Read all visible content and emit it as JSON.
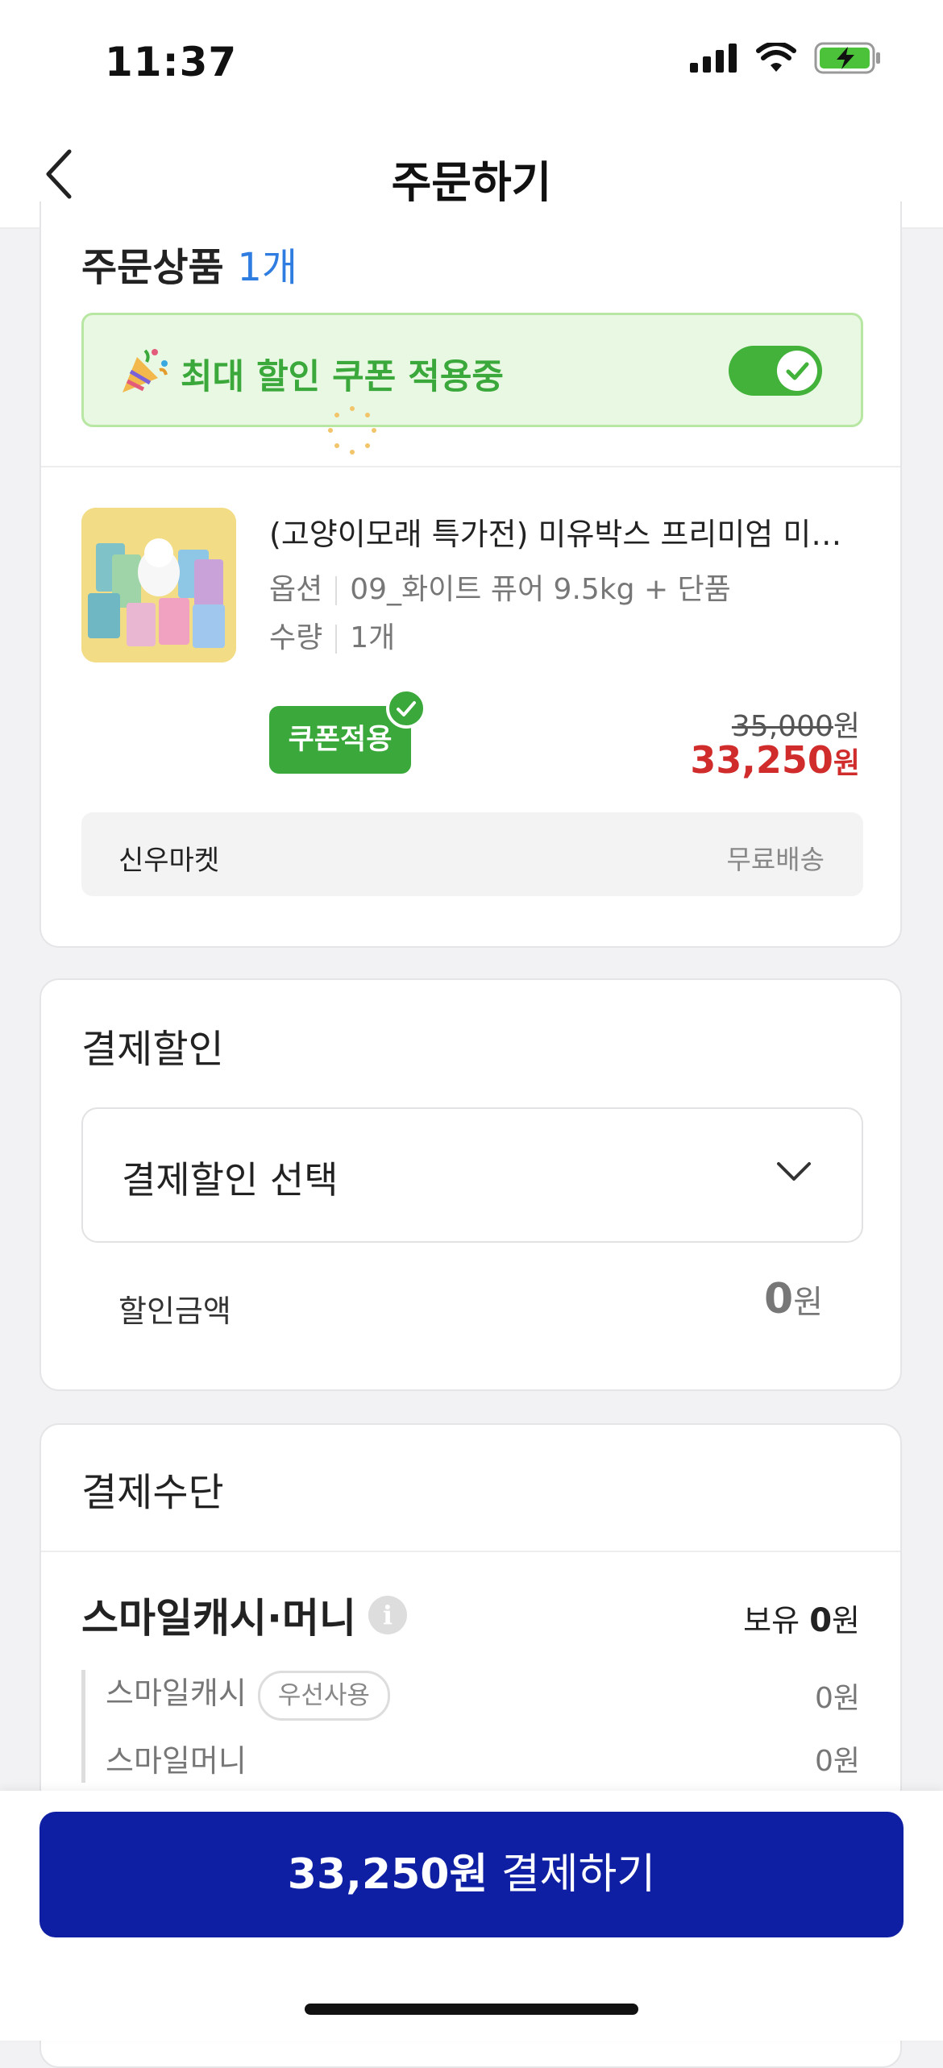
{
  "status_bar": {
    "time": "11:37"
  },
  "header": {
    "title": "주문하기"
  },
  "order_section": {
    "title": "주문상품",
    "count": "1개",
    "coupon_banner": {
      "text": "최대 할인 쿠폰 적용중",
      "toggle_on": true
    },
    "product": {
      "name": "(고양이모래 특가전) 미유박스 프리미엄 미…",
      "option_label": "옵션",
      "option_value": "09_화이트 퓨어 9.5kg + 단품",
      "qty_label": "수량",
      "qty_value": "1개",
      "coupon_badge": "쿠폰적용",
      "original_price": "35,000",
      "original_price_unit": "원",
      "sale_price": "33,250",
      "sale_price_unit": "원"
    },
    "seller": {
      "name": "신우마켓",
      "shipping": "무료배송"
    }
  },
  "payment_discount": {
    "title": "결제할인",
    "select_placeholder": "결제할인 선택",
    "amount_label": "할인금액",
    "amount_value": "0",
    "amount_unit": "원"
  },
  "payment_method": {
    "title": "결제수단",
    "smile": {
      "label": "스마일캐시·머니",
      "holding_label": "보유",
      "holding_value": "0",
      "holding_unit": "원",
      "cash_label": "스마일캐시",
      "cash_pill": "우선사용",
      "cash_value": "0원",
      "money_label": "스마일머니",
      "money_value": "0원"
    }
  },
  "pay_button": {
    "amount": "33,250원",
    "label": "결제하기"
  },
  "colors": {
    "accent_blue": "#0e1fa3",
    "green": "#3aa83a",
    "sale_red": "#d12c2c",
    "count_blue": "#2f7de0"
  }
}
